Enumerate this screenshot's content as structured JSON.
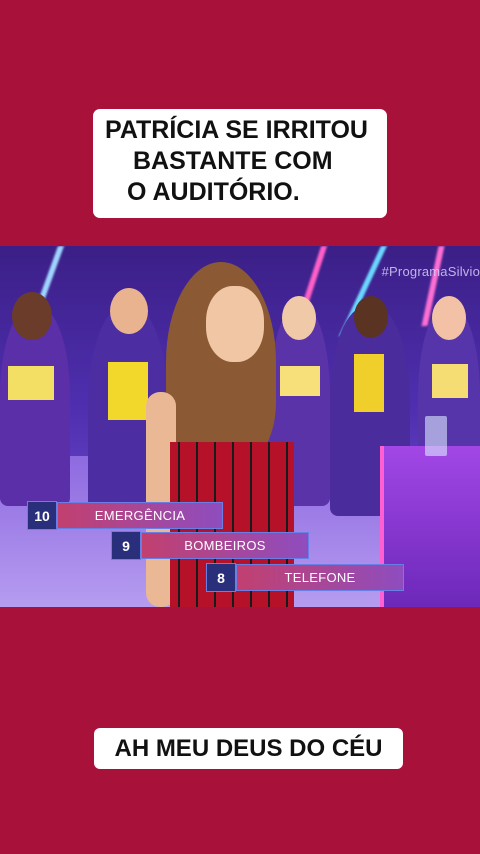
{
  "captions": {
    "top_line1": "PATRÍCIA SE IRRITOU",
    "top_line2": "BASTANTE COM",
    "top_line3": "O AUDITÓRIO.",
    "bottom": "AH MEU DEUS DO CÉU"
  },
  "video": {
    "hashtag": "#ProgramaSilvio",
    "scoreboard": [
      {
        "points": "10",
        "answer": "EMERGÊNCIA"
      },
      {
        "points": "9",
        "answer": "BOMBEIROS"
      },
      {
        "points": "8",
        "answer": "TELEFONE"
      }
    ]
  },
  "colors": {
    "background": "#a8113a",
    "caption_box": "#ffffff",
    "caption_text": "#111111"
  }
}
